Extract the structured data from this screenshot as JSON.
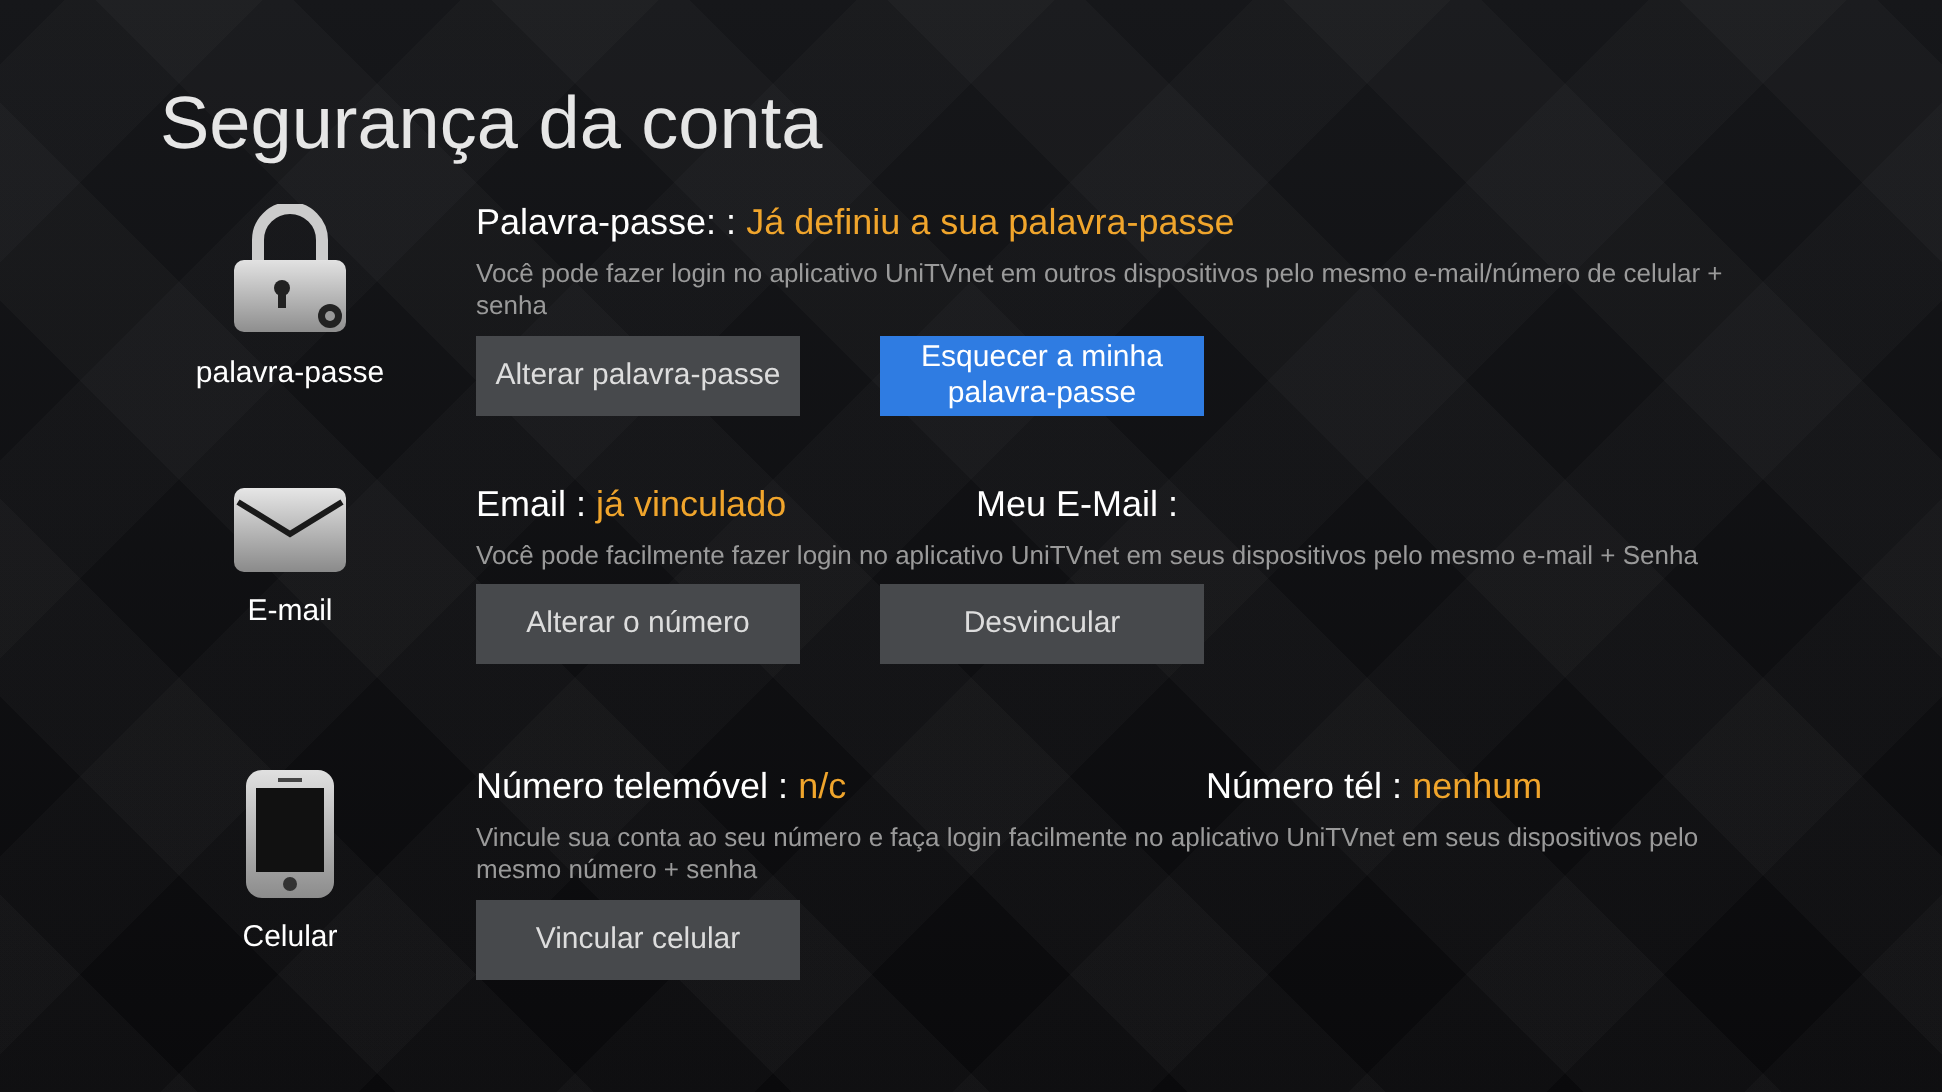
{
  "title": "Segurança da conta",
  "sections": [
    {
      "kind": "lock",
      "caption": "palavra-passe",
      "fields": [
        {
          "label": "Palavra-passe: :",
          "value": "Já definiu a sua palavra-passe"
        }
      ],
      "description": "Você pode fazer login no aplicativo UniTVnet em outros dispositivos pelo mesmo e-mail/número de celular + senha",
      "buttons": [
        {
          "label": "Alterar palavra-passe",
          "selected": false
        },
        {
          "label": "Esquecer a minha palavra-passe",
          "selected": true
        }
      ]
    },
    {
      "kind": "mail",
      "caption": "E-mail",
      "fields": [
        {
          "label": "Email :",
          "value": "já vinculado"
        },
        {
          "label": "Meu E-Mail :"
        }
      ],
      "description": "Você pode facilmente fazer login no aplicativo UniTVnet em seus dispositivos pelo mesmo e-mail + Senha",
      "buttons": [
        {
          "label": "Alterar o número",
          "selected": false
        },
        {
          "label": "Desvincular",
          "selected": false
        }
      ]
    },
    {
      "kind": "phone",
      "caption": "Celular",
      "fields": [
        {
          "label": "Número telemóvel :",
          "value": "n/c"
        },
        {
          "label": "Número tél :",
          "value": "nenhum"
        }
      ],
      "description": "Vincule sua conta ao seu número e faça login facilmente no aplicativo UniTVnet em seus dispositivos pelo mesmo número + senha",
      "buttons": [
        {
          "label": "Vincular celular",
          "selected": false
        }
      ]
    }
  ]
}
